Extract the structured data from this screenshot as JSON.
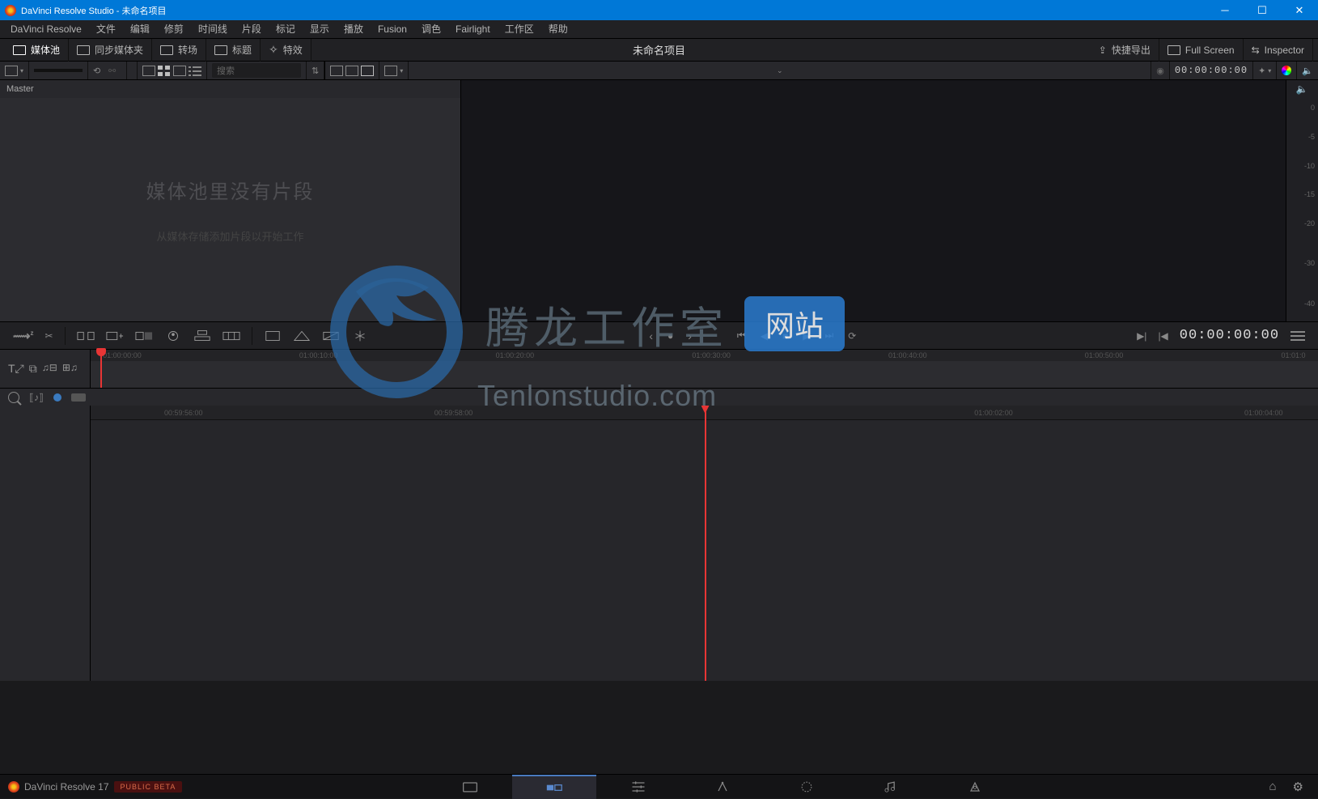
{
  "title": "DaVinci Resolve Studio - 未命名项目",
  "menu": [
    "DaVinci Resolve",
    "文件",
    "编辑",
    "修剪",
    "时间线",
    "片段",
    "标记",
    "显示",
    "播放",
    "Fusion",
    "调色",
    "Fairlight",
    "工作区",
    "帮助"
  ],
  "tabs": {
    "mediapool": "媒体池",
    "syncbin": "同步媒体夹",
    "transitions": "转场",
    "titles": "标题",
    "effects": "特效",
    "quickexport": "快捷导出",
    "fullscreen": "Full Screen",
    "inspector": "Inspector"
  },
  "project_title": "未命名项目",
  "search_placeholder": "搜索",
  "toolbar_tc": "00:00:00:00",
  "mediapool_header": "Master",
  "empty_big": "媒体池里没有片段",
  "empty_small": "从媒体存储添加片段以开始工作",
  "meter_ticks": [
    "0",
    "-5",
    "-10",
    "-15",
    "-20",
    "-30",
    "-40"
  ],
  "viewer_tc": "00:00:00:00",
  "ruler_upper": [
    "01:00:00:00",
    "01:00:10:00",
    "01:00:20:00",
    "01:00:30:00",
    "01:00:40:00",
    "01:00:50:00",
    "01:01:0"
  ],
  "ruler_lower": [
    "00:59:56:00",
    "00:59:58:00",
    "01:00:02:00",
    "01:00:04:00"
  ],
  "footer": {
    "app": "DaVinci Resolve 17",
    "beta": "PUBLIC BETA"
  },
  "watermark": {
    "text": "腾龙工作室",
    "btn": "网站",
    "url": "Tenlonstudio.com"
  }
}
